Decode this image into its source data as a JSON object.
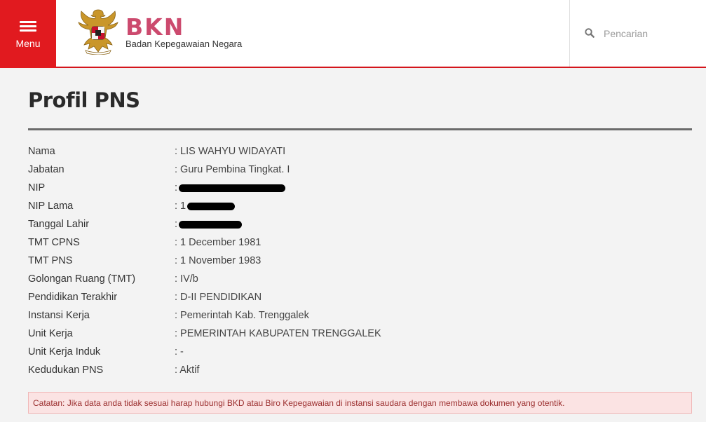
{
  "header": {
    "menu_label": "Menu",
    "brand": "BKN",
    "tagline": "Badan Kepegawaian Negara",
    "search": {
      "placeholder": "Pencarian",
      "value": ""
    },
    "accent_color": "#e11a1f",
    "brand_color": "#cc4a6e"
  },
  "page": {
    "title": "Profil PNS"
  },
  "profile": {
    "rows": [
      {
        "label": "Nama",
        "value": ": LIS WAHYU WIDAYATI"
      },
      {
        "label": "Jabatan",
        "value": ": Guru Pembina Tingkat. I"
      },
      {
        "label": "NIP",
        "value": ":"
      },
      {
        "label": "NIP Lama",
        "value": ": 1"
      },
      {
        "label": "Tanggal Lahir",
        "value": ":"
      },
      {
        "label": "TMT CPNS",
        "value": ": 1 December 1981"
      },
      {
        "label": "TMT PNS",
        "value": ": 1 November 1983"
      },
      {
        "label": "Golongan Ruang (TMT)",
        "value": ": IV/b"
      },
      {
        "label": "Pendidikan Terakhir",
        "value": ": D-II PENDIDIKAN"
      },
      {
        "label": "Instansi Kerja",
        "value": ": Pemerintah Kab. Trenggalek"
      },
      {
        "label": "Unit Kerja",
        "value": ": PEMERINTAH KABUPATEN TRENGGALEK"
      },
      {
        "label": "Unit Kerja Induk",
        "value": ": -"
      },
      {
        "label": "Kedudukan PNS",
        "value": ": Aktif"
      }
    ]
  },
  "note": {
    "text": "Catatan: Jika data anda tidak sesuai harap hubungi BKD atau Biro Kepegawaian di instansi saudara dengan membawa dokumen yang otentik."
  }
}
